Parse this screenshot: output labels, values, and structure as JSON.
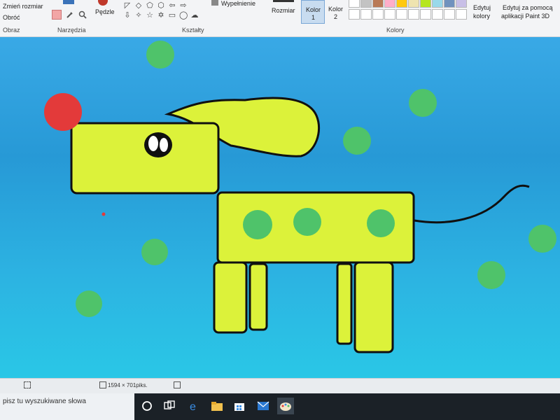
{
  "ribbon": {
    "zmien_rozmiar": "Zmień rozmiar",
    "obroc": "Obróć",
    "obraz_label": "Obraz",
    "narzedzia_label": "Narzędzia",
    "pedzle": "Pędzle",
    "ksztalty_label": "Kształty",
    "wypelnienie": "Wypełnienie",
    "rozmiar": "Rozmiar",
    "kolor1": "Kolor",
    "kolor1_num": "1",
    "kolor2": "Kolor",
    "kolor2_num": "2",
    "kolory_label": "Kolory",
    "edytuj_kolory_1": "Edytuj",
    "edytuj_kolory_2": "kolory",
    "paint3d_1": "Edytuj za pomocą",
    "paint3d_2": "aplikacji Paint 3D"
  },
  "palette": {
    "top_row": [
      "#ffffff",
      "#c3c3c3",
      "#b97a57",
      "#ffaec9",
      "#ffc90e",
      "#efe4b0",
      "#b5e61d",
      "#99d9ea",
      "#7092be",
      "#c8bfe7"
    ],
    "bottom_row": [
      "#ffffff",
      "#ffffff",
      "#ffffff",
      "#ffffff",
      "#ffffff",
      "#ffffff",
      "#ffffff",
      "#ffffff",
      "#ffffff",
      "#ffffff"
    ]
  },
  "colors": {
    "dog_body": "#dcf23a",
    "outline": "#101010",
    "nose": "#e33a3a",
    "spots": "#4fc36a"
  },
  "status": {
    "dimensions": "1594 × 701piks."
  },
  "taskbar": {
    "search_placeholder": "pisz tu wyszukiwane słowa"
  }
}
